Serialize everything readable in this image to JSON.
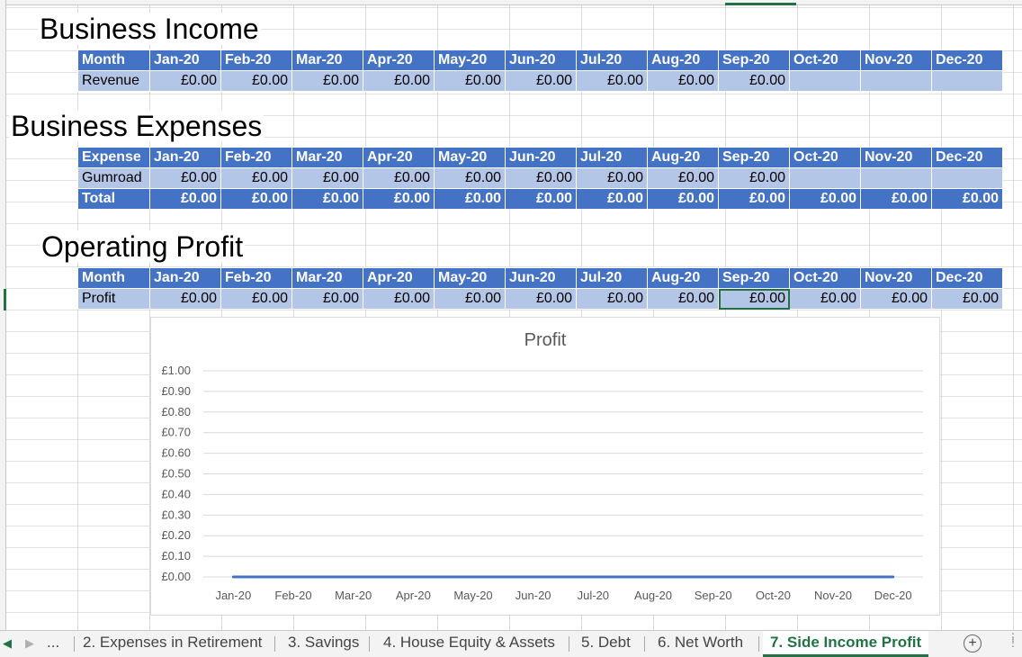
{
  "sections": {
    "income_title": "Business Income",
    "expenses_title": "Business Expenses",
    "profit_title": "Operating Profit"
  },
  "months": [
    "Jan-20",
    "Feb-20",
    "Mar-20",
    "Apr-20",
    "May-20",
    "Jun-20",
    "Jul-20",
    "Aug-20",
    "Sep-20",
    "Oct-20",
    "Nov-20",
    "Dec-20"
  ],
  "income": {
    "header_label": "Month",
    "row_label": "Revenue",
    "values": [
      "£0.00",
      "£0.00",
      "£0.00",
      "£0.00",
      "£0.00",
      "£0.00",
      "£0.00",
      "£0.00",
      "£0.00",
      "",
      "",
      ""
    ]
  },
  "expenses": {
    "header_label": "Expense",
    "row_label": "Gumroad",
    "values": [
      "£0.00",
      "£0.00",
      "£0.00",
      "£0.00",
      "£0.00",
      "£0.00",
      "£0.00",
      "£0.00",
      "£0.00",
      "",
      "",
      ""
    ],
    "total_label": "Total",
    "totals": [
      "£0.00",
      "£0.00",
      "£0.00",
      "£0.00",
      "£0.00",
      "£0.00",
      "£0.00",
      "£0.00",
      "£0.00",
      "£0.00",
      "£0.00",
      "£0.00"
    ]
  },
  "profit": {
    "header_label": "Month",
    "row_label": "Profit",
    "values": [
      "£0.00",
      "£0.00",
      "£0.00",
      "£0.00",
      "£0.00",
      "£0.00",
      "£0.00",
      "£0.00",
      "£0.00",
      "£0.00",
      "£0.00",
      "£0.00"
    ],
    "selected_index": 8
  },
  "chart_data": {
    "type": "line",
    "title": "Profit",
    "categories": [
      "Jan-20",
      "Feb-20",
      "Mar-20",
      "Apr-20",
      "May-20",
      "Jun-20",
      "Jul-20",
      "Aug-20",
      "Sep-20",
      "Oct-20",
      "Nov-20",
      "Dec-20"
    ],
    "series": [
      {
        "values": [
          0,
          0,
          0,
          0,
          0,
          0,
          0,
          0,
          0,
          0,
          0,
          0
        ],
        "color": "#4472c4"
      }
    ],
    "ylim": [
      0,
      1
    ],
    "yticks": [
      "£0.00",
      "£0.10",
      "£0.20",
      "£0.30",
      "£0.40",
      "£0.50",
      "£0.60",
      "£0.70",
      "£0.80",
      "£0.90",
      "£1.00"
    ],
    "grid": true,
    "xlabel": "",
    "ylabel": ""
  },
  "tabs": {
    "overflow_label": "...",
    "items": [
      "2. Expenses in Retirement",
      "3. Savings",
      "4. House Equity & Assets",
      "5. Debt",
      "6. Net Worth",
      "7. Side Income Profit"
    ],
    "active_index": 5,
    "add_icon": "plus-circle-icon"
  },
  "colors": {
    "header_blue": "#4472c4",
    "value_blue": "#b4c6e7",
    "excel_green": "#217346"
  }
}
